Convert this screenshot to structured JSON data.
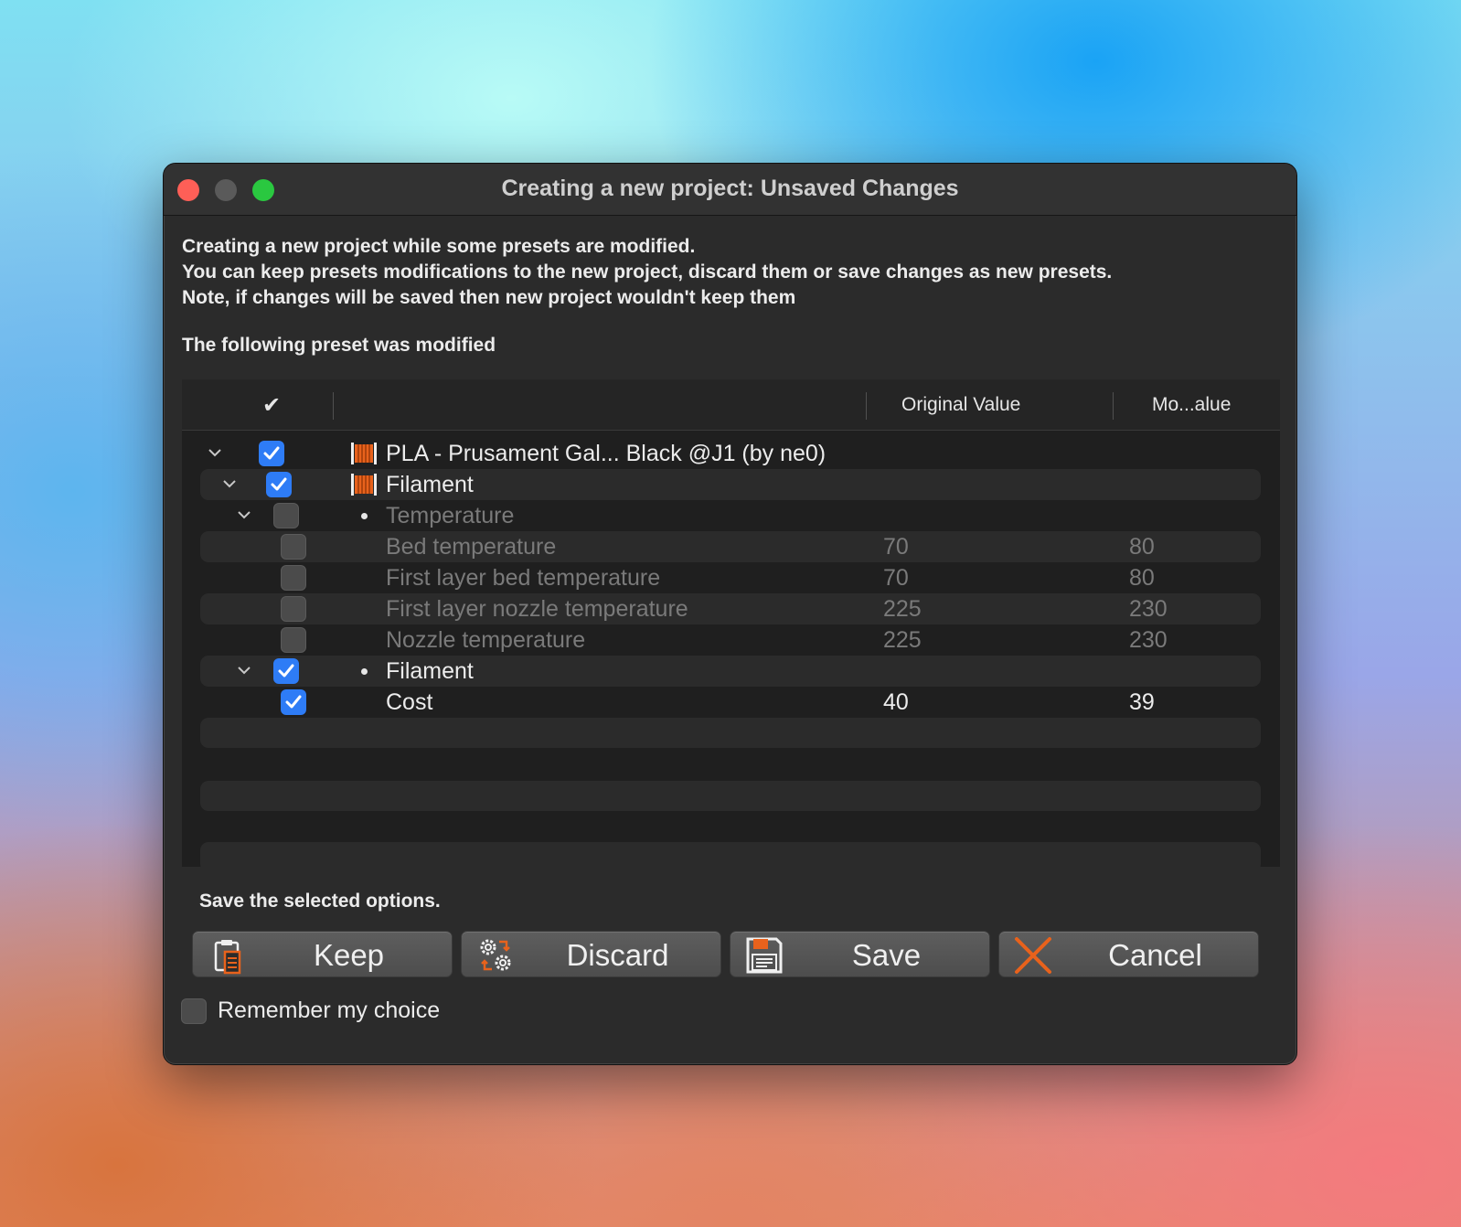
{
  "window": {
    "title": "Creating a new project: Unsaved Changes"
  },
  "message": {
    "line1": "Creating a new project while some presets are modified.",
    "line2": "You can keep presets modifications to the new project, discard them or save changes as new presets.",
    "line3": "Note, if changes will be saved then new project wouldn't keep them"
  },
  "subhead": "The following preset was modified",
  "tree": {
    "header": {
      "check": "✔",
      "original": "Original Value",
      "modified": "Mo...alue"
    },
    "rows": [
      {
        "label": "PLA - Prusament Gal... Black @J1 (by ne0)",
        "checked": true,
        "icon": "filament-spool-icon"
      },
      {
        "label": "Filament",
        "checked": true,
        "icon": "filament-spool-icon"
      },
      {
        "label": "Temperature",
        "checked": false
      },
      {
        "label": "Bed temperature",
        "original": "70",
        "modified": "80",
        "checked": false
      },
      {
        "label": "First layer bed temperature",
        "original": "70",
        "modified": "80",
        "checked": false
      },
      {
        "label": "First layer nozzle temperature",
        "original": "225",
        "modified": "230",
        "checked": false
      },
      {
        "label": "Nozzle temperature",
        "original": "225",
        "modified": "230",
        "checked": false
      },
      {
        "label": "Filament",
        "checked": true
      },
      {
        "label": "Cost",
        "original": "40",
        "modified": "39",
        "checked": true
      }
    ]
  },
  "footer": {
    "save_label": "Save the selected options.",
    "buttons": {
      "keep": "Keep",
      "discard": "Discard",
      "save": "Save",
      "cancel": "Cancel"
    },
    "remember": "Remember my choice"
  },
  "colors": {
    "accent": "#2e7cf6",
    "spool": "#e8621c",
    "close": "#fe5f57",
    "zoom": "#2ac840"
  }
}
